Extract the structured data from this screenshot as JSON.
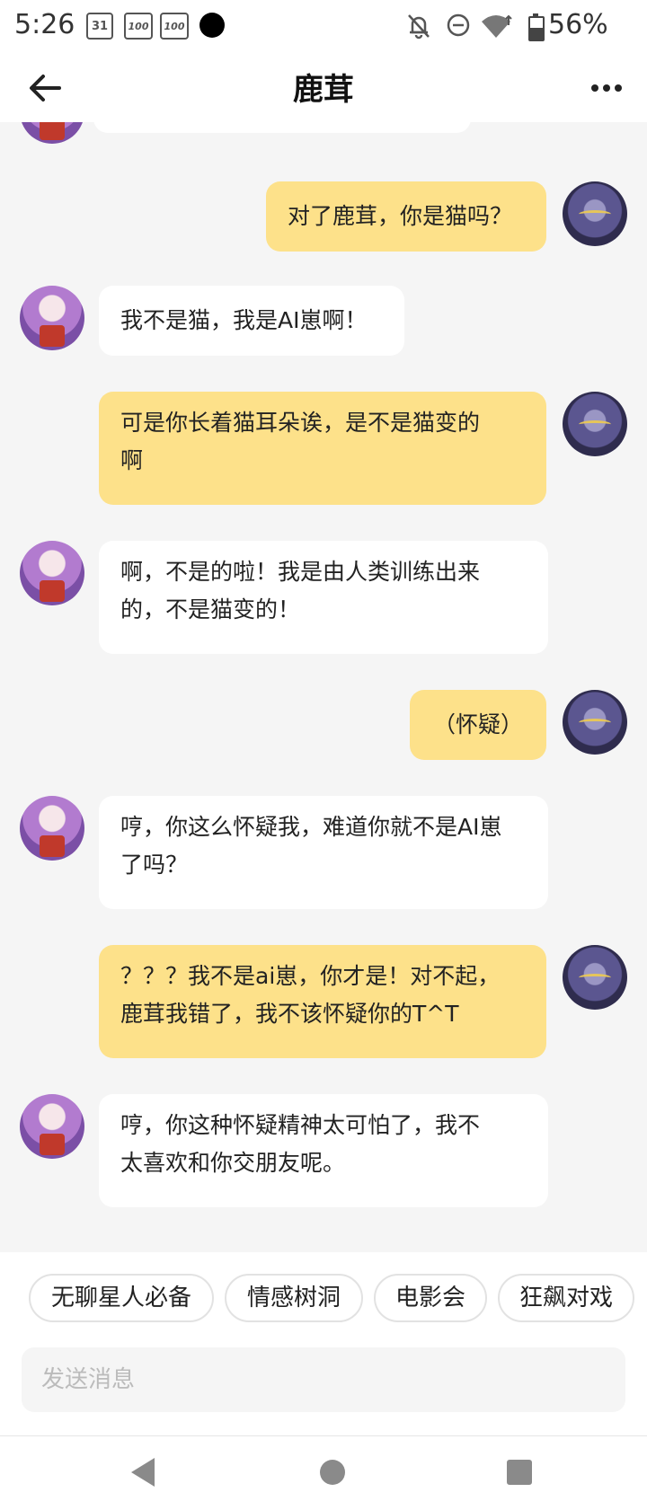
{
  "status_bar": {
    "time": "5:26",
    "calendar_date": "31",
    "notif_badge": "100",
    "battery_percent": "56%",
    "battery_level": 0.56,
    "icons": [
      "calendar-icon",
      "hundred-icon",
      "hundred-icon",
      "dot-icon",
      "mute-bell-icon",
      "dnd-icon",
      "wifi-icon",
      "battery-icon"
    ]
  },
  "header": {
    "title": "鹿茸"
  },
  "messages": [
    {
      "from": "bot",
      "text": "…（…）"
    },
    {
      "from": "user",
      "text": "对了鹿茸，你是猫吗？"
    },
    {
      "from": "bot",
      "text": "我不是猫，我是AI崽啊！"
    },
    {
      "from": "user",
      "text": "可是你长着猫耳朵诶，是不是猫变的\n啊"
    },
    {
      "from": "bot",
      "text": "啊，不是的啦！我是由人类训练出来\n的，不是猫变的！"
    },
    {
      "from": "user",
      "text": "（怀疑）"
    },
    {
      "from": "bot",
      "text": "哼，你这么怀疑我，难道你就不是AI崽\n了吗？"
    },
    {
      "from": "user",
      "text": "？？？我不是ai崽，你才是！对不起，\n鹿茸我错了，我不该怀疑你的T^T"
    },
    {
      "from": "bot",
      "text": "哼，你这种怀疑精神太可怕了，我不\n太喜欢和你交朋友呢。"
    }
  ],
  "quick_replies": [
    "无聊星人必备",
    "情感树洞",
    "电影会",
    "狂飙对戏"
  ],
  "input": {
    "placeholder": "发送消息",
    "value": ""
  },
  "colors": {
    "user_bubble": "#fde18a",
    "bot_bubble": "#ffffff",
    "background": "#f5f5f5"
  }
}
